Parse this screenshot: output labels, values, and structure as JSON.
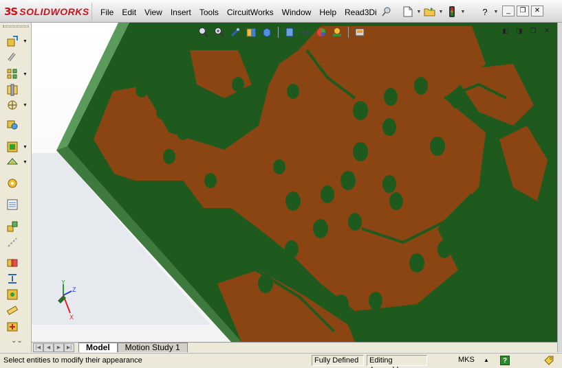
{
  "app": {
    "logo_mark": "3S",
    "logo_text": "SOLIDWORKS"
  },
  "menu": [
    "File",
    "Edit",
    "View",
    "Insert",
    "Tools",
    "CircuitWorks",
    "Window",
    "Help",
    "Read3Di"
  ],
  "quick_access": {
    "icons": [
      "new-document-icon",
      "open-folder-icon",
      "traffic-light-icon",
      "help-icon"
    ],
    "help_glyph": "?"
  },
  "window_controls": [
    "minimize-icon",
    "restore-icon",
    "close-icon"
  ],
  "viewport_controls": [
    "tile-left-icon",
    "tile-right-icon",
    "restore-icon",
    "close-icon"
  ],
  "heads_up_toolbar": [
    "zoom-to-fit-icon",
    "zoom-to-area-icon",
    "previous-view-icon",
    "section-view-icon",
    "view-orientation-icon",
    "display-style-icon",
    "hide-show-icon",
    "edit-appearance-icon",
    "apply-scene-icon",
    "view-settings-icon"
  ],
  "left_toolbar": [
    "insert-components-icon",
    "mate-icon",
    "linear-component-pattern-icon",
    "smart-fasteners-icon",
    "move-component-icon",
    "show-hidden-components-icon",
    "assembly-features-icon",
    "reference-geometry-icon",
    "new-motion-study-icon",
    "bill-of-materials-icon",
    "exploded-view-icon",
    "explode-line-sketch-icon",
    "interference-detection-icon",
    "clearance-verification-icon",
    "hole-alignment-icon",
    "measure-icon",
    "mass-properties-icon",
    "assembly-visualization-icon"
  ],
  "triad": {
    "x": "X",
    "y": "Y",
    "z": "Z"
  },
  "tabs": [
    {
      "label": "Model",
      "active": true
    },
    {
      "label": "Motion Study 1",
      "active": false
    }
  ],
  "status": {
    "message": "Select entities to modify their appearance",
    "definition": "Fully Defined",
    "mode": "Editing Assembly",
    "units": "MKS",
    "help": "?"
  },
  "colors": {
    "copper": "#8b4513",
    "solder_mask": "#1e5a1e",
    "board_edge": "#5a9a5a",
    "brand": "#d0101a"
  }
}
